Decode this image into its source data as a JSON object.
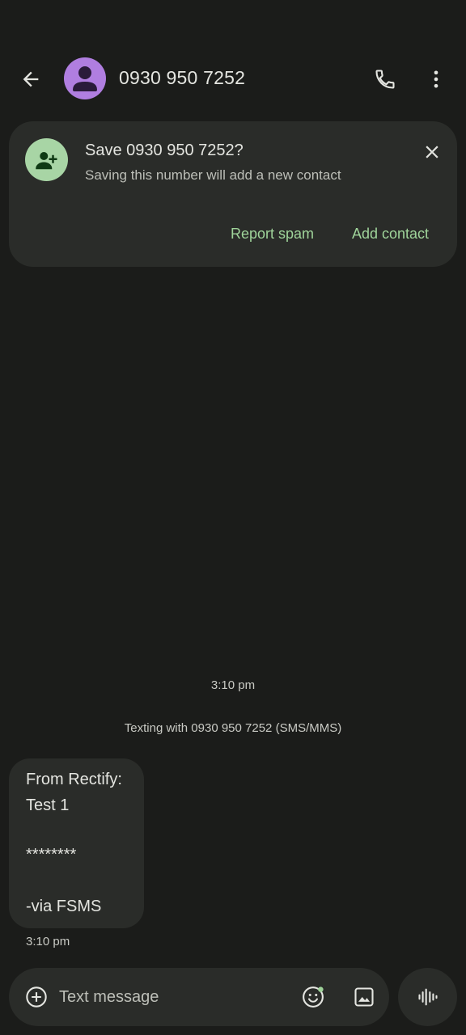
{
  "header": {
    "contact_name": "0930 950 7252",
    "avatar_color": "#b07ee0",
    "back_icon": "arrow-back-icon",
    "call_icon": "phone-icon",
    "more_icon": "more-vert-icon"
  },
  "save_card": {
    "title": "Save 0930 950 7252?",
    "subtitle": "Saving this number will add a new contact",
    "icon": "person-add-icon",
    "icon_bg": "#a8d5a5",
    "close_icon": "close-icon",
    "report_spam_label": "Report spam",
    "add_contact_label": "Add contact",
    "accent": "#9fd49a"
  },
  "conversation": {
    "date_timestamp": "3:10 pm",
    "texting_with": "Texting with 0930 950 7252 (SMS/MMS)",
    "messages": [
      {
        "lines": [
          "From Rectify:",
          "Test 1",
          "",
          "********",
          "",
          "-via FSMS"
        ],
        "time": "3:10 pm"
      }
    ]
  },
  "composer": {
    "placeholder": "Text message",
    "value": "",
    "add_icon": "add-circle-icon",
    "emoji_icon": "emoji-icon",
    "gallery_icon": "gallery-icon",
    "voice_icon": "voice-waveform-icon"
  }
}
